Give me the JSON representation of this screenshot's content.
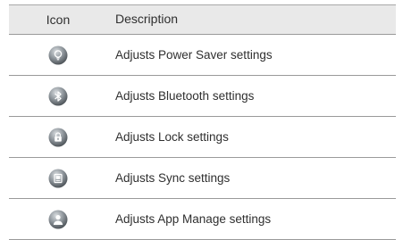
{
  "table": {
    "headers": {
      "icon": "Icon",
      "description": "Description"
    },
    "rows": [
      {
        "icon": "power-saver-icon",
        "description": "Adjusts Power Saver settings"
      },
      {
        "icon": "bluetooth-icon",
        "description": "Adjusts Bluetooth settings"
      },
      {
        "icon": "lock-icon",
        "description": "Adjusts Lock settings"
      },
      {
        "icon": "sync-icon",
        "description": "Adjusts Sync settings"
      },
      {
        "icon": "app-manage-icon",
        "description": "Adjusts App Manage settings"
      }
    ]
  },
  "colors": {
    "header_bg": "#e9e9e9",
    "divider": "#9a9a9a",
    "icon_gradient_top": "#c7ccd0",
    "icon_gradient_bottom": "#5e646a"
  }
}
